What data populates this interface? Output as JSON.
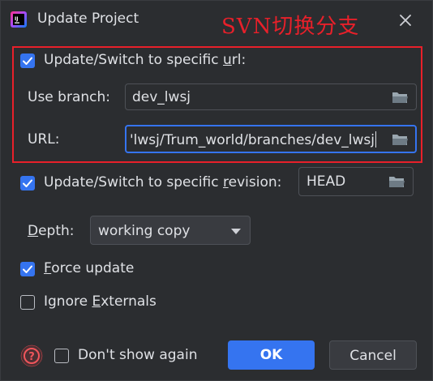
{
  "window": {
    "title": "Update Project",
    "annotation_text": "SVN切换分支"
  },
  "options": {
    "switch_url": {
      "checked": true,
      "label_before": "Update/Switch to specific ",
      "label_mnemonic": "u",
      "label_after": "rl:"
    },
    "use_branch": {
      "label": "Use branch:",
      "value": "dev_lwsj"
    },
    "url": {
      "label": "URL:",
      "value": "'lwsj/Trum_world/branches/dev_lwsj"
    },
    "switch_revision": {
      "checked": true,
      "label_before": "Update/Switch to specific ",
      "label_mnemonic": "r",
      "label_after": "evision:",
      "value": "HEAD"
    },
    "depth": {
      "label_mnemonic": "D",
      "label_after": "epth:",
      "selected": "working copy"
    },
    "force_update": {
      "checked": true,
      "label_mnemonic": "F",
      "label_after": "orce update"
    },
    "ignore_externals": {
      "checked": false,
      "label_before": "Ignore ",
      "label_mnemonic": "E",
      "label_after": "xternals"
    }
  },
  "footer": {
    "dont_show_again": {
      "checked": false,
      "label": "Don't show again"
    },
    "ok_label": "OK",
    "cancel_label": "Cancel"
  },
  "colors": {
    "accent": "#3574f0",
    "annotation_red": "#e8202a",
    "background": "#2b2d30"
  }
}
